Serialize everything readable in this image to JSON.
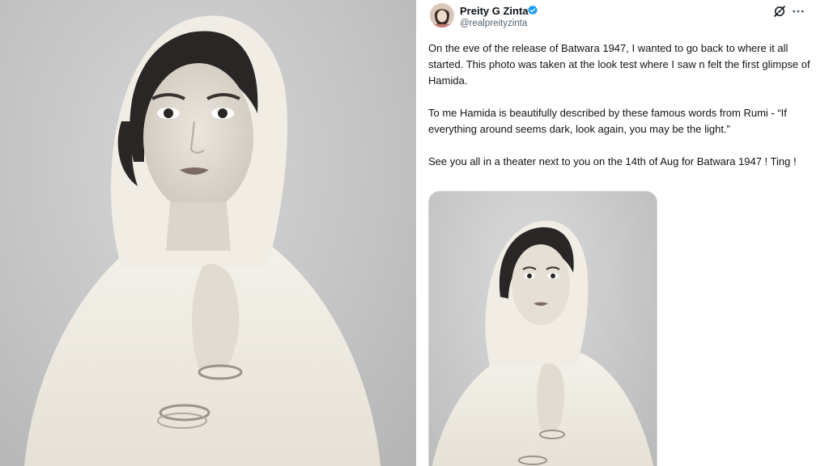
{
  "left_image": {
    "alt_icon": "portrait-photo"
  },
  "tweet": {
    "author": {
      "name": "Preity G Zinta",
      "handle": "@realpreityzinta",
      "verified_color": "#1d9bf0"
    },
    "paragraphs": [
      "On the eve of the release of Batwara 1947, I wanted to go back to where it all started. This photo was taken at the look test where I saw n felt the first glimpse of Hamida.",
      "To me Hamida is beautifully described by these famous words from Rumi - “If everything around seems dark, look again, you may be the light.”",
      "See you all in a theater next to you on the 14th of Aug for Batwara 1947 ! Ting !"
    ],
    "icons": {
      "grok": "grok-icon",
      "more": "more-options-icon"
    }
  },
  "colors": {
    "text_primary": "#0f1419",
    "text_secondary": "#536471",
    "accent": "#1d9bf0"
  }
}
